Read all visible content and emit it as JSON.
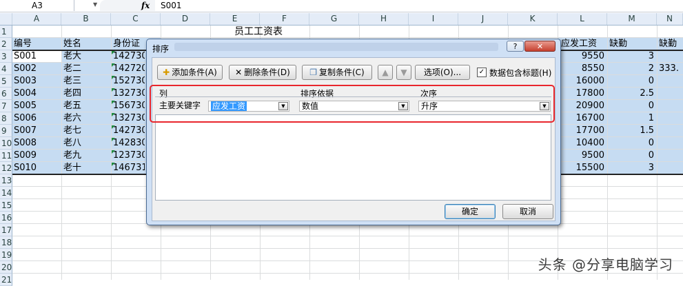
{
  "formula_bar": {
    "name_box": "A3",
    "fx": "fx",
    "value": "S001"
  },
  "columns": [
    "A",
    "B",
    "C",
    "D",
    "E",
    "F",
    "G",
    "H",
    "I",
    "J",
    "K",
    "L",
    "M",
    "N"
  ],
  "rows": [
    "1",
    "2",
    "3",
    "4",
    "5",
    "6",
    "7",
    "8",
    "9",
    "10",
    "11",
    "12",
    "13",
    "14",
    "15",
    "16",
    "17",
    "18",
    "19",
    "20",
    "21"
  ],
  "sheet": {
    "title": "员工工资表",
    "headers": {
      "a": "编号",
      "b": "姓名",
      "c": "身份证",
      "l": "应发工资",
      "m": "缺勤",
      "n": "缺勤"
    },
    "records": [
      {
        "id": "S001",
        "name": "老大",
        "idc": "142730",
        "pay": "9550",
        "absence": "3",
        "extra": ""
      },
      {
        "id": "S002",
        "name": "老二",
        "idc": "142720",
        "pay": "8550",
        "absence": "2",
        "extra": "333."
      },
      {
        "id": "S003",
        "name": "老三",
        "idc": "152730",
        "pay": "16000",
        "absence": "0",
        "extra": ""
      },
      {
        "id": "S004",
        "name": "老四",
        "idc": "132730",
        "pay": "17800",
        "absence": "2.5",
        "extra": ""
      },
      {
        "id": "S005",
        "name": "老五",
        "idc": "156730",
        "pay": "20900",
        "absence": "0",
        "extra": ""
      },
      {
        "id": "S006",
        "name": "老六",
        "idc": "132730",
        "pay": "16700",
        "absence": "1",
        "extra": ""
      },
      {
        "id": "S007",
        "name": "老七",
        "idc": "142730",
        "pay": "17700",
        "absence": "1.5",
        "extra": ""
      },
      {
        "id": "S008",
        "name": "老八",
        "idc": "142830",
        "pay": "10400",
        "absence": "0",
        "extra": ""
      },
      {
        "id": "S009",
        "name": "老九",
        "idc": "123730",
        "pay": "9500",
        "absence": "0",
        "extra": ""
      },
      {
        "id": "S010",
        "name": "老十",
        "idc": "146731",
        "pay": "15500",
        "absence": "3",
        "extra": ""
      }
    ]
  },
  "dialog": {
    "title": "排序",
    "help_label": "?",
    "close_label": "✕",
    "toolbar": {
      "add": "添加条件(A)",
      "delete": "删除条件(D)",
      "copy": "复制条件(C)",
      "options": "选项(O)...",
      "has_header": "数据包含标题(H)",
      "has_header_checked": true
    },
    "list_headers": {
      "column": "列",
      "sort_on": "排序依据",
      "order": "次序"
    },
    "rule": {
      "label": "主要关键字",
      "column_value": "应发工资",
      "sort_on_value": "数值",
      "order_value": "升序"
    },
    "ok": "确定",
    "cancel": "取消"
  },
  "watermark": "头条 @分享电脑学习",
  "colors": {
    "highlight": "#c6dcf2",
    "annotation": "#e8262c"
  }
}
